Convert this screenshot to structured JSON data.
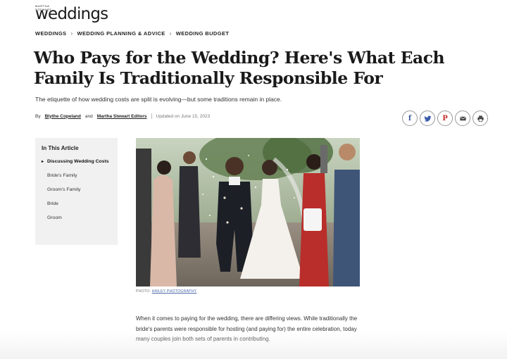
{
  "brand": {
    "supertext": "MARTHA STEWART",
    "name": "weddings"
  },
  "breadcrumb": [
    "WEDDINGS",
    "WEDDING PLANNING & ADVICE",
    "WEDDING BUDGET"
  ],
  "article": {
    "title": "Who Pays for the Wedding? Here's What Each Family Is Traditionally Responsible For",
    "subtitle": "The etiquette of how wedding costs are split is evolving—but some traditions remain in place.",
    "byline": {
      "by": "By",
      "author1": "Blythe Copeland",
      "and": "and",
      "author2": "Martha Stewart Editors",
      "updated": "Updated on June 15, 2023"
    },
    "photo_credit": {
      "label": "PHOTO:",
      "name": "HAILEY PHOTOGRAPHY"
    },
    "body": "When it comes to paying for the wedding, there are differing views. While traditionally the bride's parents were responsible for hosting (and paying for) the entire celebration, today many couples join both sets of parents in contributing."
  },
  "toc": {
    "heading": "In This Article",
    "items": [
      "Discussing Wedding Costs",
      "Bride's Family",
      "Groom's Family",
      "Bride",
      "Groom"
    ]
  },
  "share": [
    {
      "icon": "facebook-icon",
      "glyph": "f"
    },
    {
      "icon": "twitter-icon"
    },
    {
      "icon": "pinterest-icon",
      "glyph": "P"
    },
    {
      "icon": "email-icon"
    },
    {
      "icon": "print-icon"
    }
  ],
  "colors": {
    "twitter": "#3b5bab",
    "pinterest": "#c62b2b",
    "credit_link": "#4a67a8"
  }
}
